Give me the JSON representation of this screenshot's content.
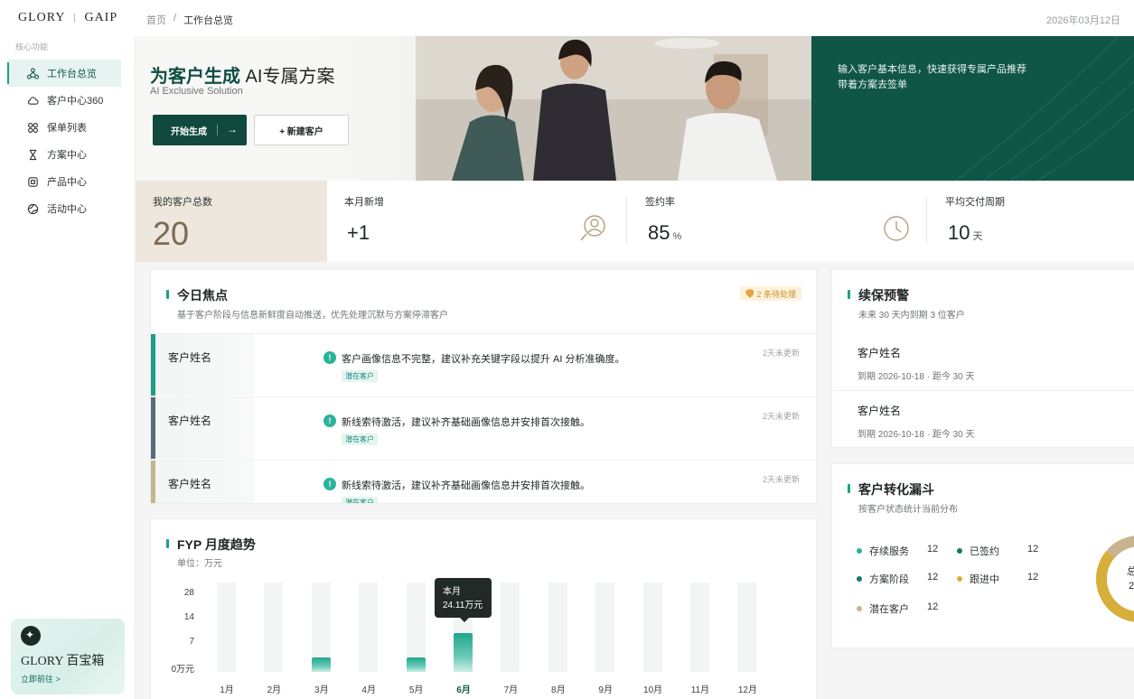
{
  "topbar": {
    "logo_left": "GLORY",
    "logo_right": "GAIP",
    "breadcrumb_home": "首页",
    "breadcrumb_sep": "/",
    "breadcrumb_current": "工作台总览",
    "date": "2026年03月12日"
  },
  "sidebar": {
    "section_label": "核心功能",
    "items": [
      {
        "label": "工作台总览",
        "icon": "workbench-icon",
        "active": true
      },
      {
        "label": "客户中心360",
        "icon": "cloud-icon",
        "active": false
      },
      {
        "label": "保单列表",
        "icon": "grid-icon",
        "active": false
      },
      {
        "label": "方案中心",
        "icon": "hourglass-icon",
        "active": false
      },
      {
        "label": "产品中心",
        "icon": "box-icon",
        "active": false
      },
      {
        "label": "活动中心",
        "icon": "globe-icon",
        "active": false
      }
    ],
    "toolbox": {
      "title": "GLORY 百宝箱",
      "link": "立即前往 >"
    }
  },
  "hero": {
    "title_strong": "为客户生成",
    "title_light": " AI专属方案",
    "subtitle": "AI Exclusive Solution",
    "primary_button": "开始生成",
    "primary_arrow": "→",
    "secondary_button": "+ 新建客户",
    "right_line1": "输入客户基本信息，快速获得专属产品推荐",
    "right_line2": "带着方案去签单"
  },
  "stats": [
    {
      "label": "我的客户总数",
      "value": "20",
      "unit": ""
    },
    {
      "label": "本月新增",
      "value": "+1",
      "unit": ""
    },
    {
      "label": "签约率",
      "value": "85",
      "unit": "%"
    },
    {
      "label": "平均交付周期",
      "value": "10",
      "unit": "天"
    }
  ],
  "focus": {
    "title": "今日焦点",
    "subtitle": "基于客户阶段与信息新鲜度自动推送，优先处理沉默与方案停滞客户",
    "badge": "2 条待处理",
    "rows": [
      {
        "name": "客户姓名",
        "message": "客户画像信息不完整，建议补充关键字段以提升 AI 分析准确度。",
        "tag": "潜在客户",
        "updated": "2天未更新"
      },
      {
        "name": "客户姓名",
        "message": "新线索待激活，建议补齐基础画像信息并安排首次接触。",
        "tag": "潜在客户",
        "updated": "2天未更新"
      },
      {
        "name": "客户姓名",
        "message": "新线索待激活，建议补齐基础画像信息并安排首次接触。",
        "tag": "潜在客户",
        "updated": "2天未更新"
      }
    ]
  },
  "renewal": {
    "title": "续保预警",
    "subtitle": "未来 30 天内到期 3 位客户",
    "items": [
      {
        "name": "客户姓名",
        "detail": "到期 2026-10-18 · 距今 30 天"
      },
      {
        "name": "客户姓名",
        "detail": "到期 2026-10-18 · 距今 30 天"
      }
    ]
  },
  "funnel": {
    "title": "客户转化漏斗",
    "subtitle": "按客户状态统计当前分布",
    "legend": [
      {
        "label": "存续服务",
        "count": "12",
        "color": "#2bb39a"
      },
      {
        "label": "已签约",
        "count": "12",
        "color": "#127a66"
      },
      {
        "label": "方案阶段",
        "count": "12",
        "color": "#127a66"
      },
      {
        "label": "跟进中",
        "count": "12",
        "color": "#d7ae3a"
      },
      {
        "label": "潜在客户",
        "count": "12",
        "color": "#c8b38f"
      }
    ],
    "donut_center_top": "总",
    "donut_center_bottom": "2"
  },
  "chart_data": {
    "type": "bar",
    "title": "FYP 月度趋势",
    "unit_label": "单位：万元",
    "categories": [
      "1月",
      "2月",
      "3月",
      "4月",
      "5月",
      "6月",
      "7月",
      "8月",
      "9月",
      "10月",
      "11月",
      "12月"
    ],
    "values": [
      0,
      0,
      3,
      0,
      3,
      24.11,
      0,
      0,
      0,
      0,
      0,
      0
    ],
    "ylim": [
      0,
      28
    ],
    "yticks": [
      "28",
      "14",
      "7",
      "0万元"
    ],
    "highlight_index": 5,
    "tooltip_title": "本月",
    "tooltip_value": "24.11万元",
    "accent": "#1aa08a"
  }
}
